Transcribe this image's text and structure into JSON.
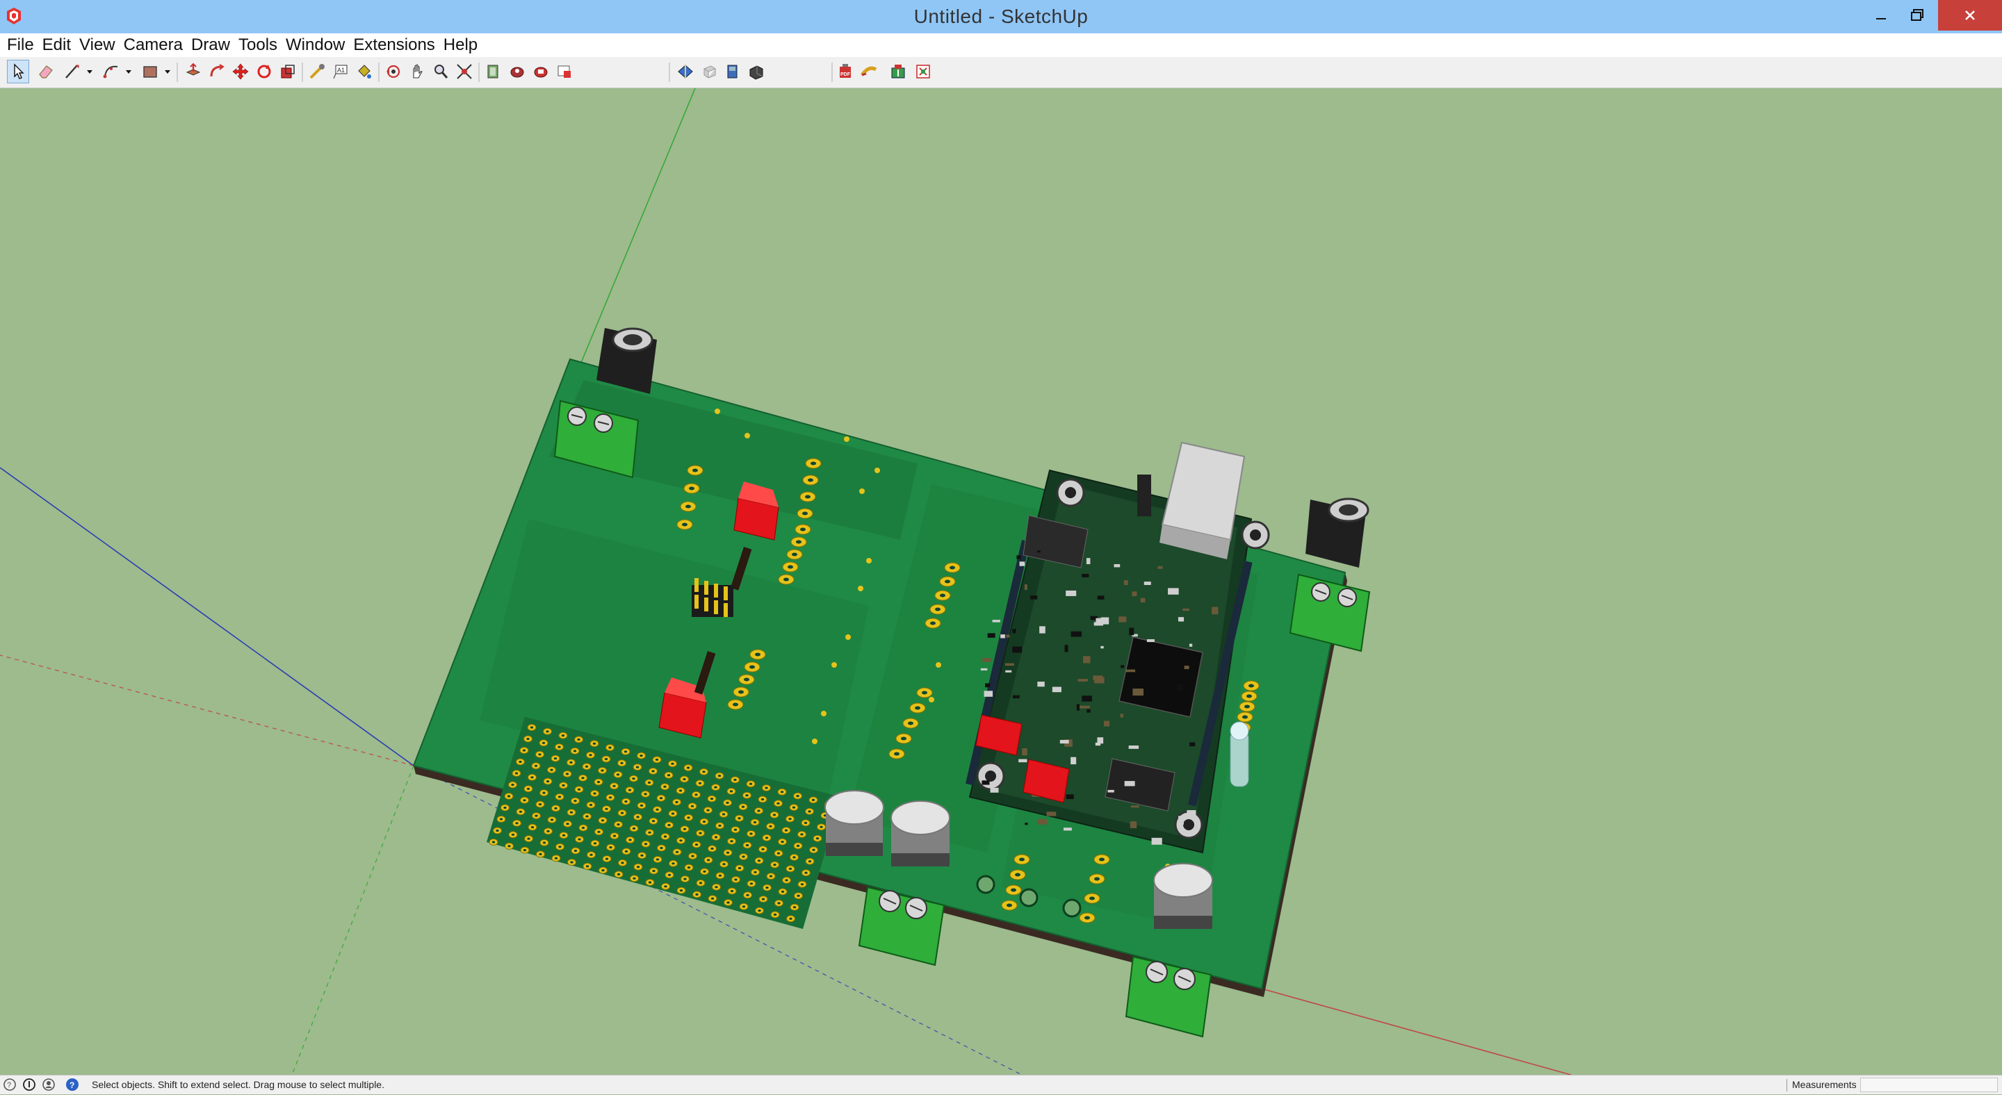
{
  "window": {
    "title": "Untitled - SketchUp"
  },
  "menu": {
    "items": [
      "File",
      "Edit",
      "View",
      "Camera",
      "Draw",
      "Tools",
      "Window",
      "Extensions",
      "Help"
    ]
  },
  "toolbar": {
    "tools": [
      {
        "name": "select-tool-icon",
        "active": true
      },
      {
        "name": "eraser-tool-icon"
      },
      {
        "name": "line-tool-icon"
      },
      {
        "name": "arc-tool-icon"
      },
      {
        "name": "rectangle-tool-icon"
      },
      {
        "name": "push-pull-tool-icon"
      },
      {
        "name": "follow-me-tool-icon"
      },
      {
        "name": "move-tool-icon"
      },
      {
        "name": "rotate-tool-icon"
      },
      {
        "name": "scale-tool-icon"
      },
      {
        "name": "tape-measure-tool-icon"
      },
      {
        "name": "text-tool-icon"
      },
      {
        "name": "paint-bucket-tool-icon"
      },
      {
        "name": "orbit-tool-icon"
      },
      {
        "name": "pan-tool-icon"
      },
      {
        "name": "zoom-tool-icon"
      },
      {
        "name": "zoom-extents-tool-icon"
      },
      {
        "name": "warehouse-icon"
      },
      {
        "name": "share-model-icon"
      },
      {
        "name": "extension-warehouse-icon"
      },
      {
        "name": "extension-manager-icon"
      },
      {
        "name": "section-plane-icon"
      },
      {
        "name": "xray-style-icon"
      },
      {
        "name": "back-edges-style-icon"
      },
      {
        "name": "shaded-textures-icon"
      },
      {
        "name": "export-pdf-icon"
      },
      {
        "name": "tape-extension-icon"
      },
      {
        "name": "import-idf-icon"
      },
      {
        "name": "export-idf-icon"
      }
    ]
  },
  "status": {
    "hint": "Select objects. Shift to extend select. Drag mouse to select multiple.",
    "measurements_label": "Measurements",
    "measurements_value": ""
  },
  "colors": {
    "viewport_bg": "#9dbb8d",
    "pcb_top": "#1f8a45",
    "pcb_edge": "#3a2a20",
    "pad_gold": "#e6c31a",
    "terminal_green": "#2fae3a",
    "button_red": "#e3141b",
    "axis_red": "#c04040",
    "axis_green": "#30a030",
    "axis_blue": "#3030b0",
    "titlebar": "#8fc6f6"
  }
}
